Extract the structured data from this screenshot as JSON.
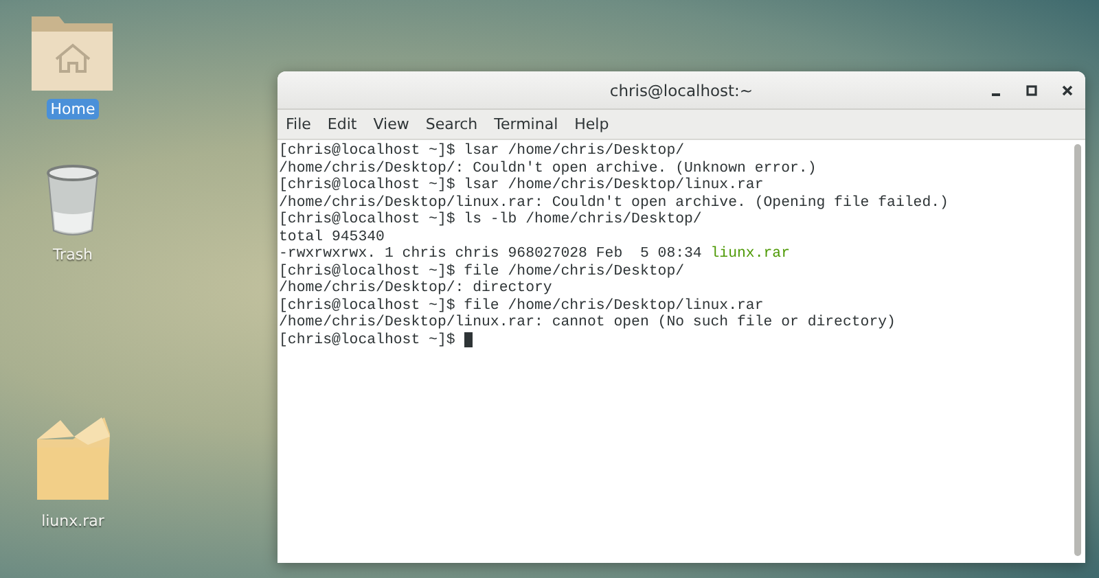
{
  "desktop_icons": [
    {
      "label": "Home",
      "kind": "folder",
      "selected": true
    },
    {
      "label": "Trash",
      "kind": "trash",
      "selected": false
    },
    {
      "label": "liunx.rar",
      "kind": "box",
      "selected": false
    }
  ],
  "window": {
    "title": "chris@localhost:~"
  },
  "menu": [
    "File",
    "Edit",
    "View",
    "Search",
    "Terminal",
    "Help"
  ],
  "terminal": {
    "lines": [
      {
        "parts": [
          {
            "text": "[chris@localhost ~]$ lsar /home/chris/Desktop/",
            "kind": "plain"
          }
        ]
      },
      {
        "parts": [
          {
            "text": "/home/chris/Desktop/: Couldn't open archive. (Unknown error.)",
            "kind": "plain"
          }
        ]
      },
      {
        "parts": [
          {
            "text": "[chris@localhost ~]$ lsar /home/chris/Desktop/linux.rar",
            "kind": "plain"
          }
        ]
      },
      {
        "parts": [
          {
            "text": "/home/chris/Desktop/linux.rar: Couldn't open archive. (Opening file failed.)",
            "kind": "plain"
          }
        ]
      },
      {
        "parts": [
          {
            "text": "[chris@localhost ~]$ ls -lb /home/chris/Desktop/",
            "kind": "plain"
          }
        ]
      },
      {
        "parts": [
          {
            "text": "total 945340",
            "kind": "plain"
          }
        ]
      },
      {
        "parts": [
          {
            "text": "-rwxrwxrwx. 1 chris chris 968027028 Feb  5 08:34 ",
            "kind": "plain"
          },
          {
            "text": "liunx.rar",
            "kind": "file"
          }
        ]
      },
      {
        "parts": [
          {
            "text": "[chris@localhost ~]$ file /home/chris/Desktop/",
            "kind": "plain"
          }
        ]
      },
      {
        "parts": [
          {
            "text": "/home/chris/Desktop/: directory",
            "kind": "plain"
          }
        ]
      },
      {
        "parts": [
          {
            "text": "[chris@localhost ~]$ file /home/chris/Desktop/linux.rar",
            "kind": "plain"
          }
        ]
      },
      {
        "parts": [
          {
            "text": "/home/chris/Desktop/linux.rar: cannot open (No such file or directory)",
            "kind": "plain"
          }
        ]
      },
      {
        "parts": [
          {
            "text": "[chris@localhost ~]$ ",
            "kind": "plain"
          }
        ],
        "cursor": true
      }
    ]
  }
}
